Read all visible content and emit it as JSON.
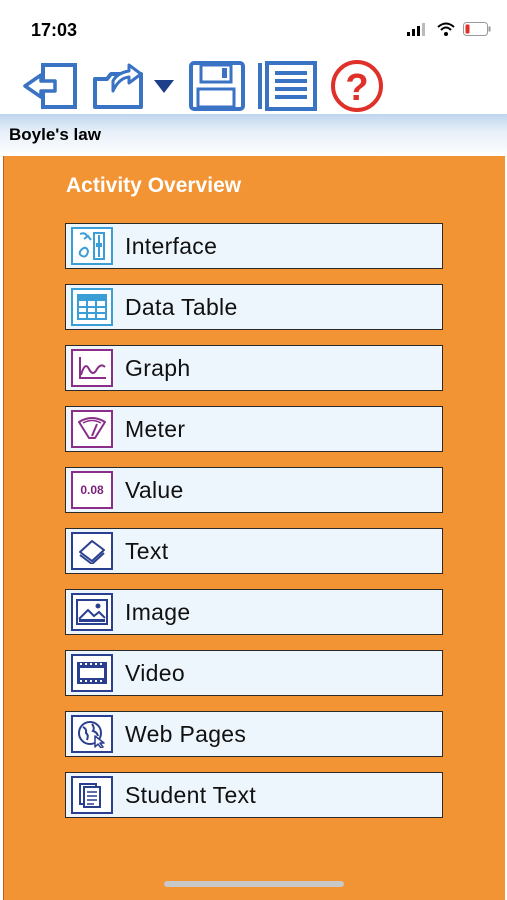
{
  "status": {
    "time": "17:03"
  },
  "toolbar": {
    "buttons": [
      {
        "icon": "exit-icon"
      },
      {
        "icon": "export-icon"
      },
      {
        "icon": "dropdown-arrow-icon"
      },
      {
        "icon": "save-icon"
      },
      {
        "icon": "notes-icon"
      },
      {
        "icon": "help-icon"
      }
    ],
    "help_symbol": "?"
  },
  "document": {
    "title": "Boyle's law"
  },
  "overview": {
    "title": "Activity Overview",
    "items": [
      {
        "label": "Interface",
        "icon": "interface-icon"
      },
      {
        "label": "Data Table",
        "icon": "data-table-icon"
      },
      {
        "label": "Graph",
        "icon": "graph-icon"
      },
      {
        "label": "Meter",
        "icon": "meter-icon"
      },
      {
        "label": "Value",
        "icon": "value-icon",
        "icon_text": "0.08"
      },
      {
        "label": "Text",
        "icon": "text-icon"
      },
      {
        "label": "Image",
        "icon": "image-icon"
      },
      {
        "label": "Video",
        "icon": "video-icon"
      },
      {
        "label": "Web Pages",
        "icon": "web-pages-icon"
      },
      {
        "label": "Student Text",
        "icon": "student-text-icon"
      }
    ]
  },
  "colors": {
    "accent": "#f29433",
    "toolbar_blue": "#3a72c4",
    "help_red": "#e0302a"
  }
}
